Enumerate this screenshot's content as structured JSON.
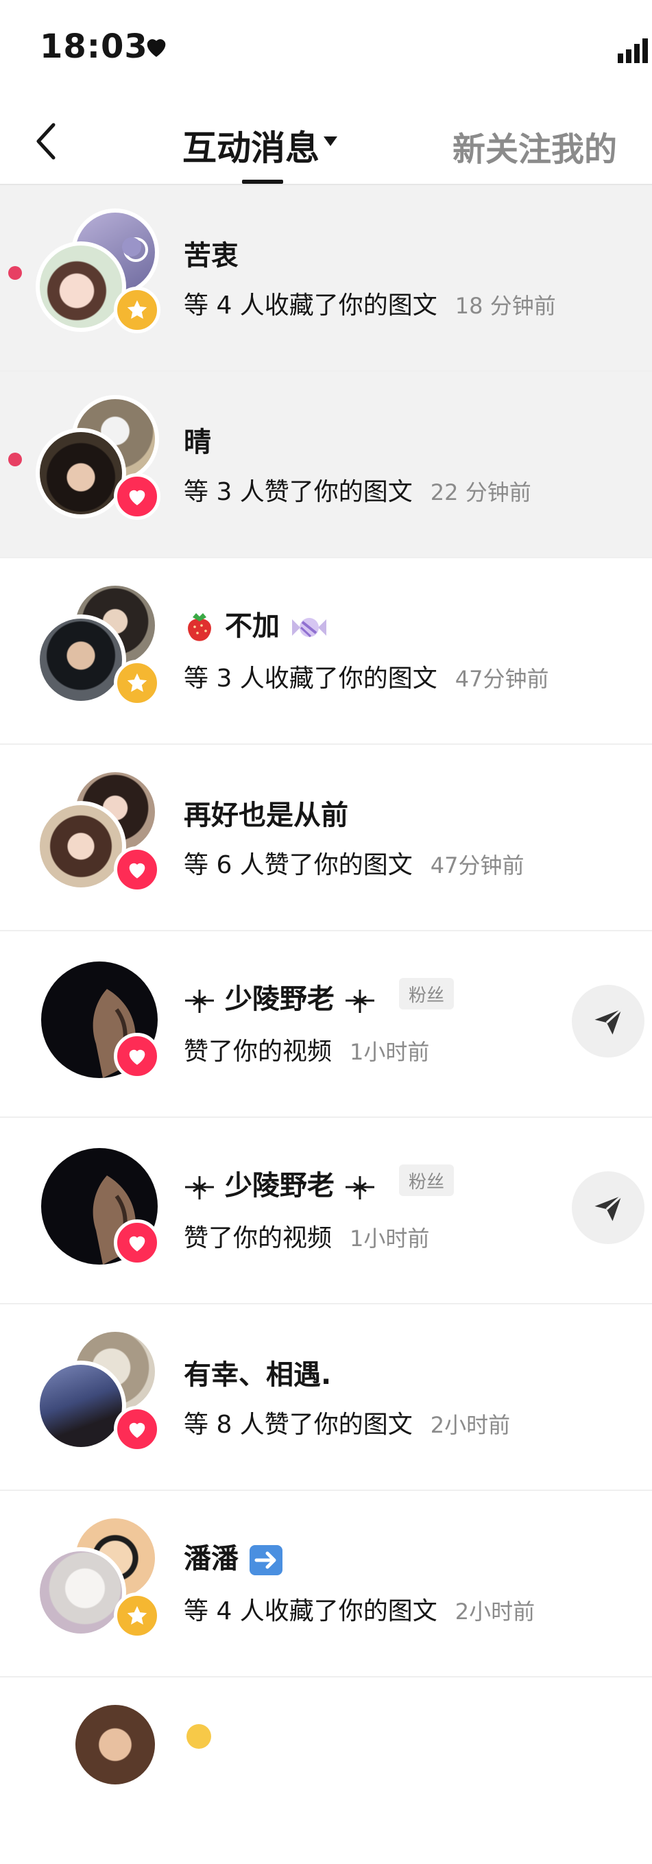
{
  "status": {
    "time": "18:03"
  },
  "nav": {
    "title": "互动消息",
    "right_tab": "新关注我的"
  },
  "notifications": [
    {
      "name": "苦衷",
      "action": "等 4 人收藏了你的图文",
      "time": "18 分钟前",
      "badge": "star",
      "unread": true
    },
    {
      "name": "晴",
      "action": "等 3 人赞了你的图文",
      "time": "22 分钟前",
      "badge": "heart",
      "unread": true
    },
    {
      "name": "不加",
      "action": "等 3 人收藏了你的图文",
      "time": "47分钟前",
      "badge": "star",
      "unread": false
    },
    {
      "name": "再好也是从前",
      "action": "等 6 人赞了你的图文",
      "time": "47分钟前",
      "badge": "heart",
      "unread": false
    },
    {
      "name": "少陵野老",
      "tag": "粉丝",
      "action": "赞了你的视频",
      "time": "1小时前",
      "badge": "heart",
      "unread": false
    },
    {
      "name": "少陵野老",
      "tag": "粉丝",
      "action": "赞了你的视频",
      "time": "1小时前",
      "badge": "heart",
      "unread": false
    },
    {
      "name": "有幸、相遇.",
      "action": "等 8 人赞了你的图文",
      "time": "2小时前",
      "badge": "heart",
      "unread": false
    },
    {
      "name": "潘潘",
      "action": "等 4 人收藏了你的图文",
      "time": "2小时前",
      "badge": "star",
      "unread": false
    }
  ],
  "colors": {
    "unread_dot": "#e74063",
    "heart_badge": "#fe2c55",
    "star_badge": "#f5b731",
    "unread_bg": "#f2f2f2",
    "muted_text": "#8b8b8b"
  }
}
